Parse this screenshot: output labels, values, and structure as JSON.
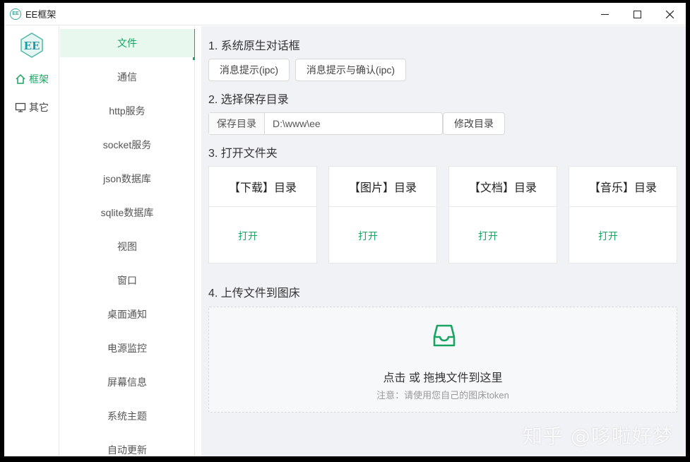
{
  "app": {
    "title": "EE框架",
    "logo_text": "EE"
  },
  "sidebar_primary": [
    {
      "label": "框架",
      "icon": "home-icon",
      "active": true
    },
    {
      "label": "其它",
      "icon": "monitor-icon",
      "active": false
    }
  ],
  "sidebar_secondary": [
    {
      "label": "文件",
      "active": true
    },
    {
      "label": "通信"
    },
    {
      "label": "http服务"
    },
    {
      "label": "socket服务"
    },
    {
      "label": "json数据库"
    },
    {
      "label": "sqlite数据库"
    },
    {
      "label": "视图"
    },
    {
      "label": "窗口"
    },
    {
      "label": "桌面通知"
    },
    {
      "label": "电源监控"
    },
    {
      "label": "屏幕信息"
    },
    {
      "label": "系统主题"
    },
    {
      "label": "自动更新"
    }
  ],
  "main": {
    "section1": {
      "title": "1. 系统原生对话框",
      "buttons": [
        "消息提示(ipc)",
        "消息提示与确认(ipc)"
      ]
    },
    "section2": {
      "title": "2. 选择保存目录",
      "addon": "保存目录",
      "path_value": "D:\\www\\ee",
      "button": "修改目录"
    },
    "section3": {
      "title": "3. 打开文件夹",
      "cards": [
        {
          "title": "【下载】目录",
          "action": "打开"
        },
        {
          "title": "【图片】目录",
          "action": "打开"
        },
        {
          "title": "【文档】目录",
          "action": "打开"
        },
        {
          "title": "【音乐】目录",
          "action": "打开"
        }
      ]
    },
    "section4": {
      "title": "4. 上传文件到图床",
      "upload_text": "点击 或 拖拽文件到这里",
      "upload_hint": "注意：请使用您自己的图床token"
    }
  },
  "watermark": "知乎 @哆啦好梦",
  "colors": {
    "accent": "#19a463",
    "active_bg": "#e8f8ee",
    "main_bg": "#f0f2f5"
  }
}
